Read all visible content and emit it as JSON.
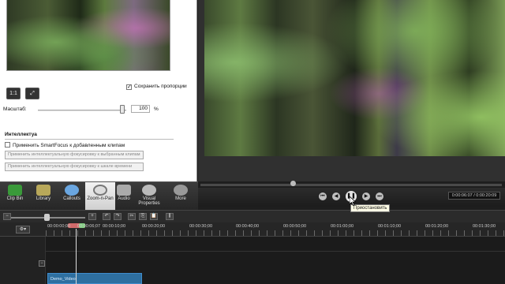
{
  "zoom_panel": {
    "btn_one_to_one": "1:1",
    "btn_fit": "⤢",
    "keep_proportions_label": "Сохранить пропорции",
    "keep_proportions_checked": true,
    "scale_label": "Масштаб:",
    "scale_value": "100",
    "scale_unit": "%",
    "smart_focus_title": "Интеллектуа",
    "smart_focus_apply_label": "Применить SmartFocus к добавленным клипам",
    "btn_apply_selected": "Применить интеллектуальную фокусировку к выбранным клипам",
    "btn_apply_timeline": "Применить интеллектуальную фокусировку к шкале времени"
  },
  "tabs": [
    {
      "label": "Clip Bin",
      "color": "#3a9a3a"
    },
    {
      "label": "Library",
      "color": "#b8a85a"
    },
    {
      "label": "Callouts",
      "color": "#6aa6e0"
    },
    {
      "label": "Zoom-n-Pan",
      "color": "#dddddd"
    },
    {
      "label": "Audio",
      "color": "#aaaaaa"
    },
    {
      "label": "Visual Properties",
      "color": "#bbbbbb"
    },
    {
      "label": "More",
      "color": "#999999"
    }
  ],
  "active_tab": "Zoom-n-Pan",
  "player": {
    "time": "0:00:06:07 / 0:00:20:09",
    "tooltip": "Приостановить",
    "progress": 0.3
  },
  "timeline": {
    "ruler_labels": [
      "00:00:00;00",
      "00:00:06;07",
      "00:00:10;00",
      "00:00:20;00",
      "00:00:30;00",
      "00:00:40;00",
      "00:00:50;00",
      "00:01:00;00",
      "00:01:10;00",
      "00:01:20;00",
      "00:01:30;00"
    ],
    "clip_label": "Demo_Video"
  }
}
